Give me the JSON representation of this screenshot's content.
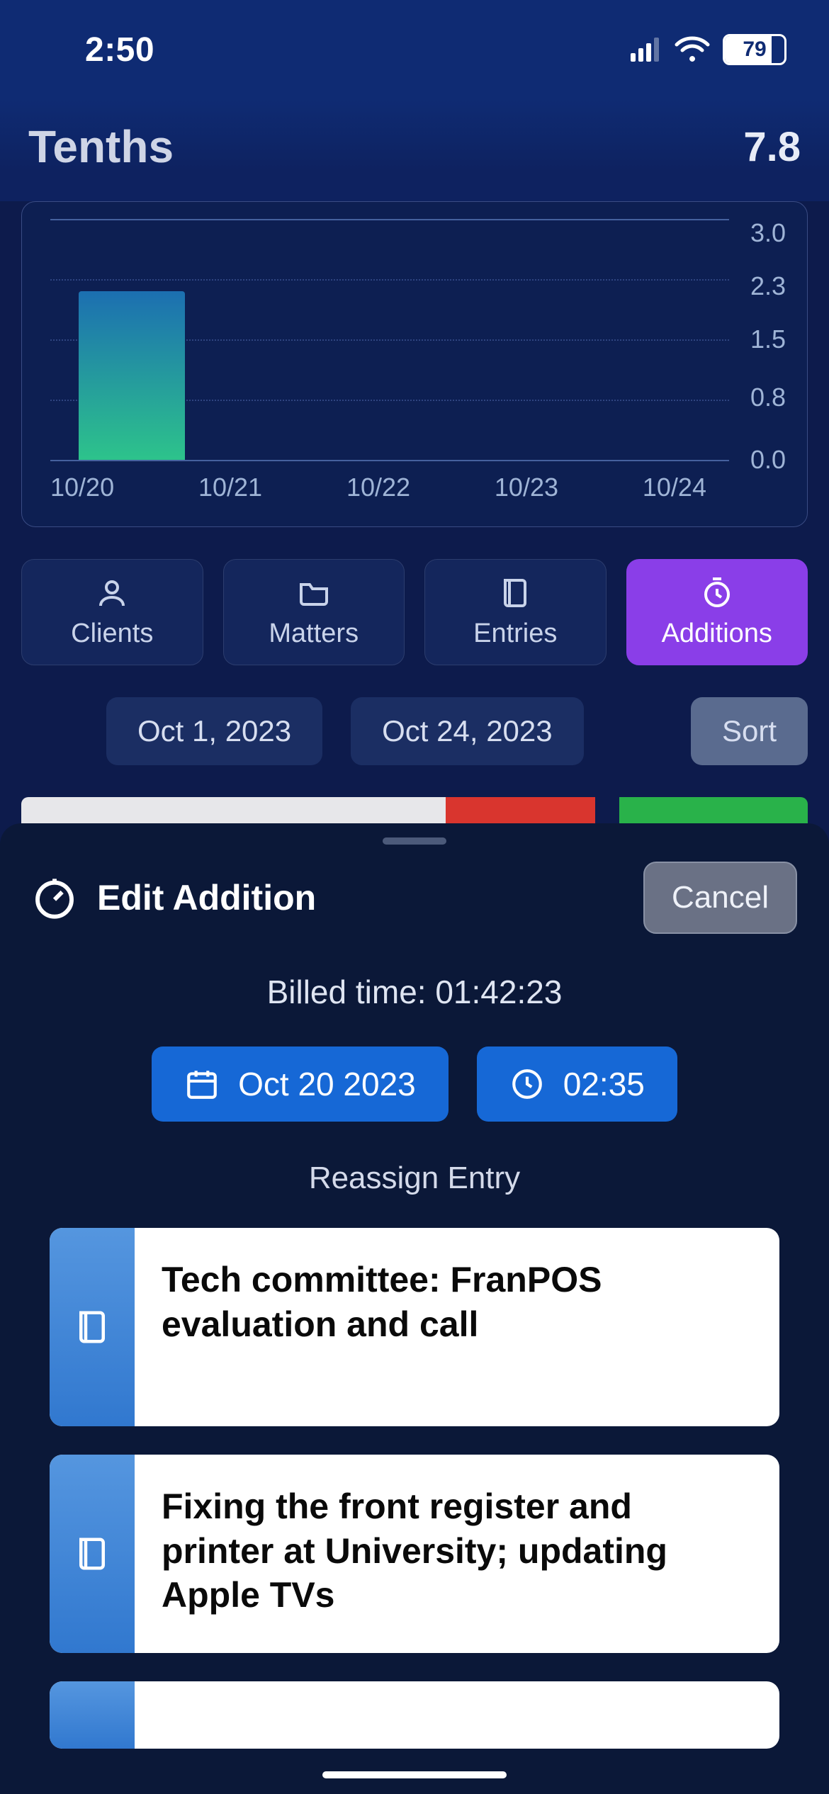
{
  "status": {
    "time": "2:50",
    "battery": "79"
  },
  "header": {
    "title": "Tenths",
    "total": "7.8"
  },
  "chart_data": {
    "type": "bar",
    "categories": [
      "10/20",
      "10/21",
      "10/22",
      "10/23",
      "10/24"
    ],
    "values": [
      2.1,
      0,
      0,
      0,
      0
    ],
    "ylabel": "",
    "xlabel": "",
    "ylim": [
      0,
      3.0
    ],
    "y_ticks": [
      "3.0",
      "2.3",
      "1.5",
      "0.8",
      "0.0"
    ]
  },
  "tabs": {
    "clients": "Clients",
    "matters": "Matters",
    "entries": "Entries",
    "additions": "Additions"
  },
  "filters": {
    "start": "Oct 1, 2023",
    "end": "Oct 24, 2023",
    "sort": "Sort"
  },
  "sheet": {
    "title": "Edit Addition",
    "cancel": "Cancel",
    "billed_label": "Billed time:",
    "billed_value": "01:42:23",
    "date": "Oct 20 2023",
    "time": "02:35",
    "reassign_label": "Reassign Entry",
    "entries": [
      "Tech committee: FranPOS evaluation and call",
      "Fixing the front register and printer at University; updating Apple TVs"
    ]
  }
}
